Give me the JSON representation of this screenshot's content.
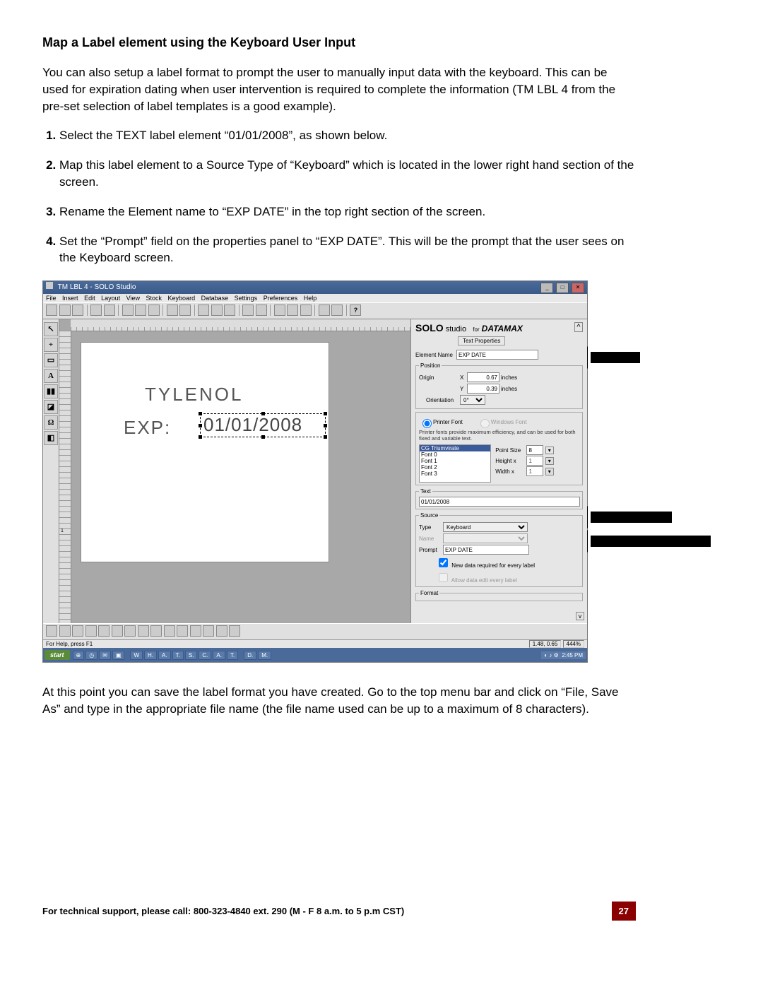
{
  "heading": "Map a Label element using the Keyboard User Input",
  "intro": "You can also setup a label format to prompt the user to manually input data with the keyboard. This can be used for expiration dating when user intervention is required to complete the information (TM LBL 4 from the pre-set selection of label templates is a good example).",
  "steps": [
    "Select the TEXT label element “01/01/2008”, as shown below.",
    "Map this label element to a Source Type of “Keyboard” which is located in the lower right hand section of the screen.",
    "Rename the Element name to “EXP DATE” in the top right section of the screen.",
    "Set the “Prompt” field on the properties panel to “EXP DATE”.  This will be the prompt that the user sees on the Keyboard screen."
  ],
  "after": "At this point you can save the label format you have created.  Go to the top menu bar and click on “File, Save As” and type in the appropriate file name (the file name used can be up to a maximum of 8 characters).",
  "footer": {
    "support": "For technical support, please call: 800-323-4840 ext. 290 (M - F  8 a.m. to 5 p.m CST)",
    "page": "27"
  },
  "app": {
    "title": "TM LBL 4 - SOLO Studio",
    "menus": [
      "File",
      "Insert",
      "Edit",
      "Layout",
      "View",
      "Stock",
      "Keyboard",
      "Database",
      "Settings",
      "Preferences",
      "Help"
    ],
    "canvas": {
      "line1": "TYLENOL",
      "line2a": "EXP:",
      "line2b": "01/01/2008"
    },
    "props": {
      "brand1": "SOLO",
      "brand2": "studio",
      "brand3": "for",
      "brand4": "DATAMAX",
      "tab": "Text Properties",
      "elementNameLabel": "Element Name",
      "elementName": "EXP DATE",
      "positionLegend": "Position",
      "originLabel": "Origin",
      "xLabel": "X",
      "xVal": "0.67",
      "yLabel": "Y",
      "yVal": "0.39",
      "unit": "inches",
      "orientationLabel": "Orientation",
      "orientation": "0°",
      "printerFont": "Printer Font",
      "windowsFont": "Windows Font",
      "fontNote": "Printer fonts provide maximum efficiency, and can be used for both fixed and variable text.",
      "fonts": [
        "CG Triumvirate",
        "Font 0",
        "Font 1",
        "Font 2",
        "Font 3"
      ],
      "pointSizeLabel": "Point Size",
      "pointSize": "8",
      "heightLabel": "Height x",
      "heightMul": "1",
      "widthLabel": "Width x",
      "widthMul": "1",
      "textLegend": "Text",
      "textVal": "01/01/2008",
      "sourceLegend": "Source",
      "typeLabel": "Type",
      "typeVal": "Keyboard",
      "nameLabel": "Name",
      "promptLabel": "Prompt",
      "promptVal": "EXP DATE",
      "chk1": "New data required for every label",
      "chk2": "Allow data edit every label",
      "formatLegend": "Format"
    },
    "status": {
      "left": "For Help, press F1",
      "coords": "1.48, 0.65",
      "zoom": "444%"
    },
    "taskbar": {
      "start": "start",
      "buttons": [
        "W",
        "H.",
        "A.",
        "T.",
        "S.",
        "C.",
        "A.",
        "T.",
        "D.",
        "M."
      ],
      "clock": "2:45 PM"
    }
  }
}
